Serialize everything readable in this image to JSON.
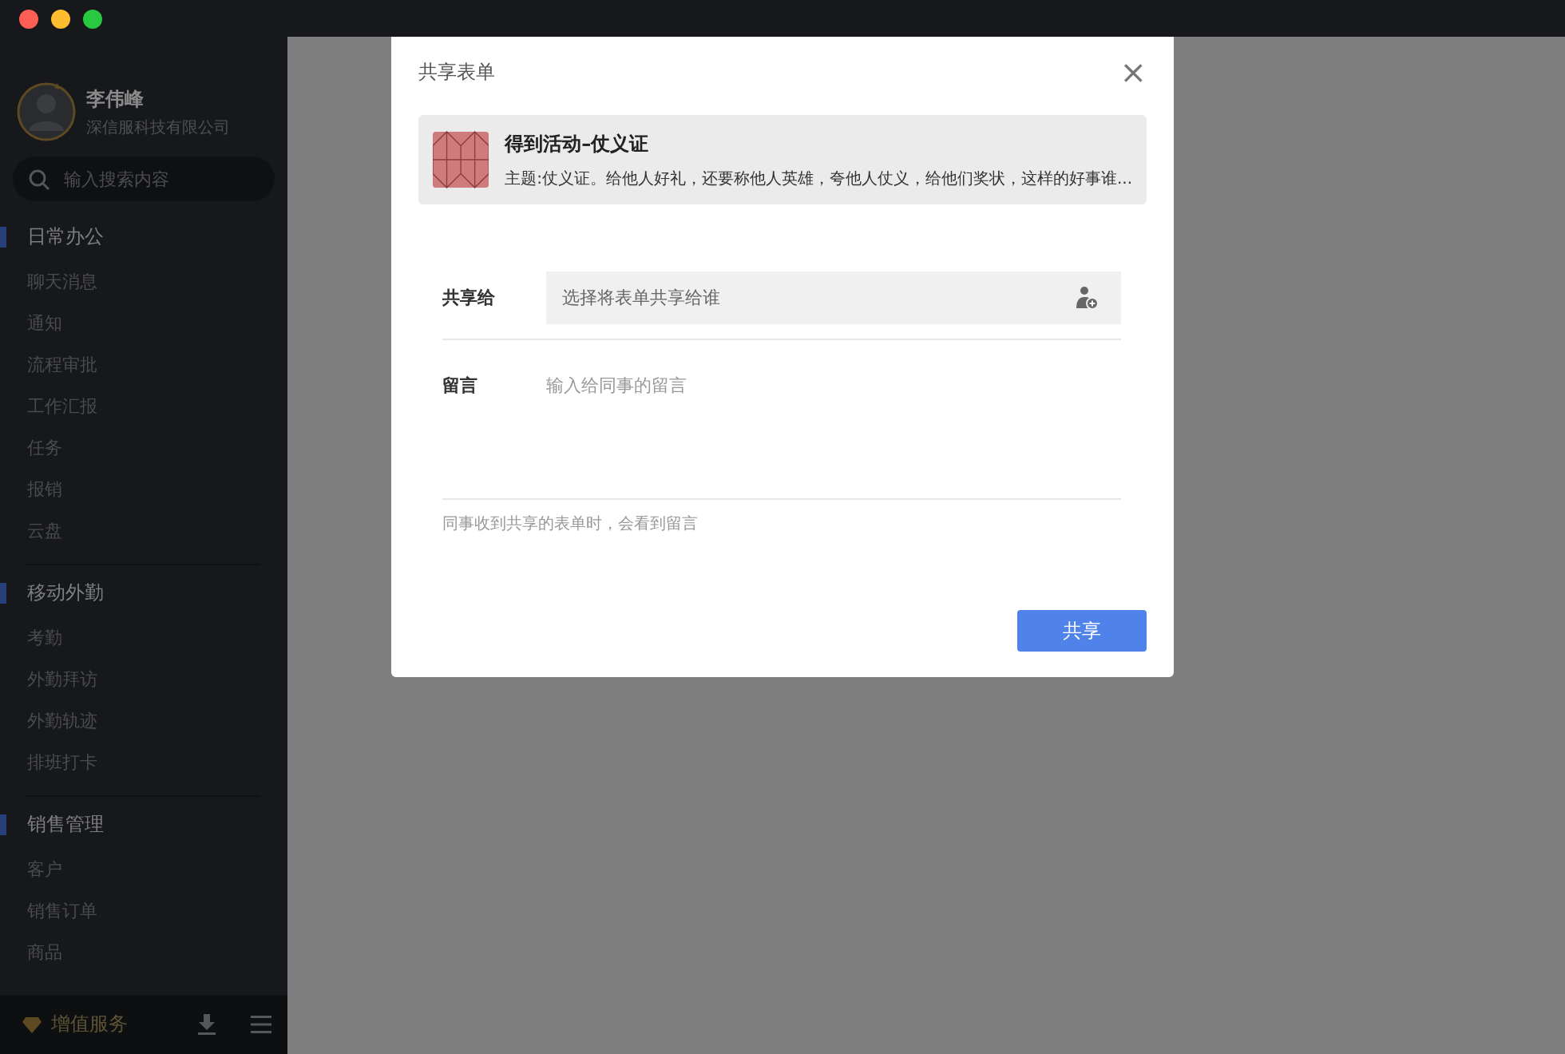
{
  "user": {
    "name": "李伟峰",
    "company": "深信服科技有限公司"
  },
  "search": {
    "placeholder": "输入搜索内容"
  },
  "sections": [
    {
      "title": "日常办公",
      "items": [
        "聊天消息",
        "通知",
        "流程审批",
        "工作汇报",
        "任务",
        "报销",
        "云盘"
      ]
    },
    {
      "title": "移动外勤",
      "items": [
        "考勤",
        "外勤拜访",
        "外勤轨迹",
        "排班打卡"
      ]
    },
    {
      "title": "销售管理",
      "items": [
        "客户",
        "销售订单",
        "商品"
      ]
    }
  ],
  "footer": {
    "label": "增值服务"
  },
  "dialog": {
    "title": "共享表单",
    "close": "×",
    "form_card": {
      "title": "得到活动–仗义证",
      "subtitle": "主题:仗义证。给他人好礼，还要称他人英雄，夸他人仗义，给他们奖状，这样的好事谁..."
    },
    "share_to": {
      "label": "共享给",
      "placeholder": "选择将表单共享给谁"
    },
    "message": {
      "label": "留言",
      "placeholder": "输入给同事的留言"
    },
    "hint": "同事收到共享的表单时，会看到留言",
    "submit": "共享"
  }
}
